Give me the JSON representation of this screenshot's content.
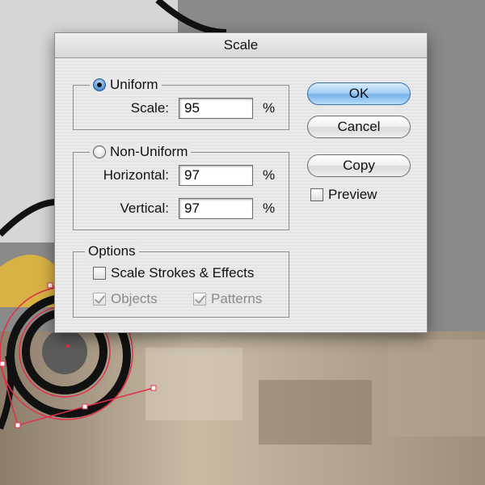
{
  "dialog": {
    "title": "Scale",
    "uniform": {
      "label": "Uniform",
      "selected": true,
      "scale_label": "Scale:",
      "scale_value": "95",
      "unit": "%"
    },
    "non_uniform": {
      "label": "Non-Uniform",
      "selected": false,
      "horizontal_label": "Horizontal:",
      "horizontal_value": "97",
      "vertical_label": "Vertical:",
      "vertical_value": "97",
      "unit": "%"
    },
    "options": {
      "label": "Options",
      "scale_strokes_label": "Scale Strokes & Effects",
      "scale_strokes_checked": false,
      "objects_label": "Objects",
      "objects_checked": true,
      "patterns_label": "Patterns",
      "patterns_checked": true
    },
    "buttons": {
      "ok_label": "OK",
      "cancel_label": "Cancel",
      "copy_label": "Copy"
    },
    "preview": {
      "label": "Preview",
      "checked": false
    }
  },
  "colors": {
    "accent": "#79b3ea",
    "selection_handle": "#e0304a"
  }
}
